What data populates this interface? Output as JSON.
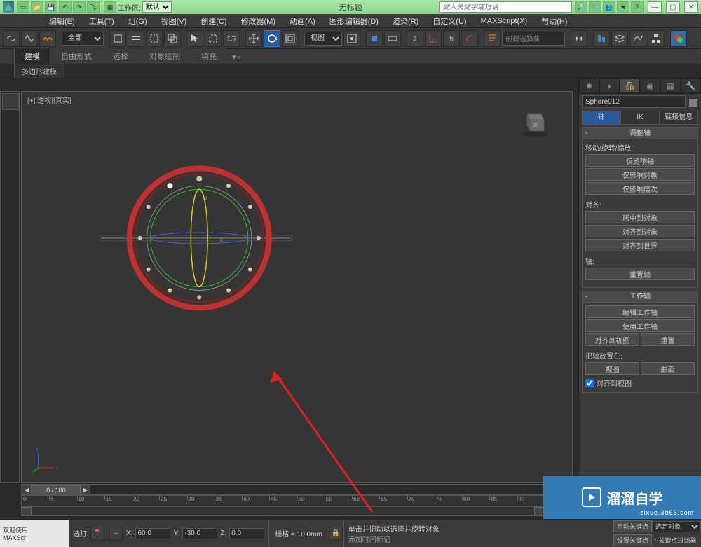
{
  "title_bar": {
    "app_title": "无标题",
    "workspace_label": "工作区:",
    "workspace_value": "默认",
    "search_placeholder": "键入关键字或短语"
  },
  "menu": {
    "edit": "编辑(E)",
    "tools": "工具(T)",
    "group": "组(G)",
    "views": "视图(V)",
    "create": "创建(C)",
    "modifiers": "修改器(M)",
    "animation": "动画(A)",
    "graph": "图形编辑器(D)",
    "rendering": "渲染(R)",
    "customize": "自定义(U)",
    "maxscript": "MAXScript(X)",
    "help": "帮助(H)"
  },
  "toolbar": {
    "filter_all": "全部",
    "ref_view": "视图",
    "selection_set": "创建选择集"
  },
  "tabs": {
    "modeling": "建模",
    "freeform": "自由形式",
    "selection": "选择",
    "object_paint": "对象绘制",
    "populate": "填充",
    "poly_modeling": "多边形建模"
  },
  "viewport": {
    "label": "[+][透视][真实]"
  },
  "timeline": {
    "frame_display": "0 / 100"
  },
  "command_panel": {
    "object_name": "Sphere012",
    "sub_tabs": {
      "pivot": "轴",
      "ik": "IK",
      "link": "链接信息"
    },
    "rollout_adjust": "调整轴",
    "section_move": "移动/旋转/缩放:",
    "btn_affect_pivot": "仅影响轴",
    "btn_affect_object": "仅影响对象",
    "btn_affect_hierarchy": "仅影响层次",
    "section_align": "对齐:",
    "btn_center_object": "居中到对象",
    "btn_align_object": "对齐到对象",
    "btn_align_world": "对齐到世界",
    "section_pivot": "轴:",
    "btn_reset_pivot": "重置轴",
    "rollout_working": "工作轴",
    "btn_edit_working": "编辑工作轴",
    "btn_use_working": "使用工作轴",
    "btn_align_view": "对齐到视图",
    "btn_reset": "重置",
    "label_place_pivot": "把轴放置在:",
    "btn_view": "视图",
    "btn_surface": "曲面",
    "check_align_view": "对齐到视图"
  },
  "status": {
    "welcome": "欢迎使用",
    "app": "MAXScr",
    "select_label": "选打",
    "x_label": "X:",
    "x_val": "60.0",
    "y_label": "Y:",
    "y_val": "-30.0",
    "z_label": "Z:",
    "z_val": "0.0",
    "grid_label": "栅格 = 10.0mm",
    "prompt": "单击并拖动以选择并旋转对象",
    "add_time_tag": "添加时间标记",
    "auto_key": "自动关键点",
    "set_key": "设置关键点",
    "key_filter": "关键点过滤器",
    "selected": "选定对象"
  },
  "watermark": {
    "text": "溜溜自学",
    "url": "zixue.3d66.com"
  }
}
